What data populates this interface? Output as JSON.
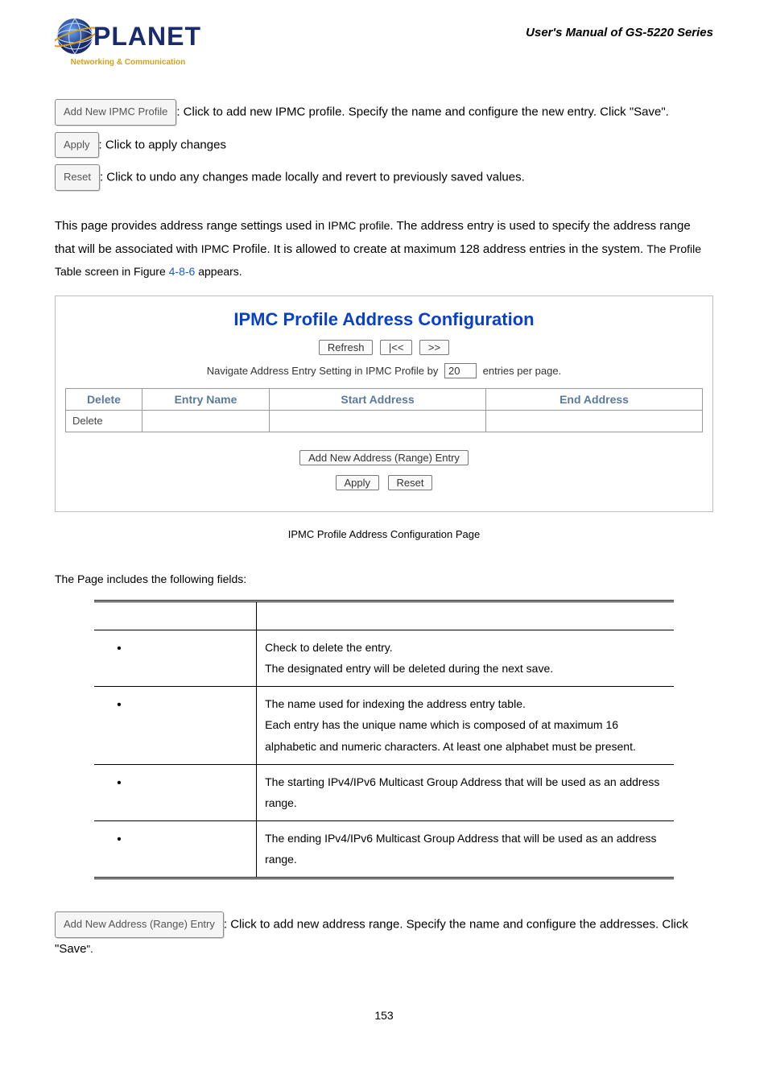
{
  "header": {
    "brand": "PLANET",
    "tagline": "Networking & Communication",
    "manual_title": "User's Manual of GS-5220 Series"
  },
  "top_buttons": {
    "add_profile": {
      "label": "Add New IPMC Profile",
      "desc": ": Click to add new IPMC profile. Specify the name and configure the new entry. Click \"Save\"."
    },
    "apply": {
      "label": "Apply",
      "desc": ": Click to apply changes"
    },
    "reset": {
      "label": "Reset",
      "desc": ": Click to undo any changes made locally and revert to previously saved values."
    }
  },
  "intro": {
    "p1a": "This page provides address range settings used in ",
    "p1b": "IPMC profile",
    "p1c": ". The address entry is used to specify the address range that will be associated with ",
    "p1d": "IPMC",
    "p1e": " Profile. It is allowed to create at maximum 128 address entries in the system. ",
    "p1f": "The Profile Table screen in Figure ",
    "fig": "4-8-6",
    "p1g": " appears."
  },
  "panel": {
    "title": "IPMC Profile Address Configuration",
    "refresh": "Refresh",
    "prev": "|<<",
    "next": ">>",
    "nav_a": "Navigate Address Entry Setting in IPMC Profile by",
    "nav_val": "20",
    "nav_b": "entries per page.",
    "th_delete": "Delete",
    "th_entry": "Entry Name",
    "th_start": "Start Address",
    "th_end": "End Address",
    "row_delete": "Delete",
    "add_range": "Add New Address (Range) Entry",
    "apply": "Apply",
    "reset": "Reset"
  },
  "caption": "IPMC Profile Address Configuration Page",
  "fields_intro": "The Page includes the following fields:",
  "fields": {
    "r1": {
      "d1": "Check to delete the entry.",
      "d2": "The designated entry will be deleted during the next save."
    },
    "r2": {
      "d1": "The name used for indexing the address entry table.",
      "d2": "Each entry has the unique name which is composed of at maximum 16 alphabetic and numeric characters. At least one alphabet must be present."
    },
    "r3": {
      "d1": "The starting IPv4/IPv6 Multicast Group Address that will be used as an address range."
    },
    "r4": {
      "d1": "The ending IPv4/IPv6 Multicast Group Address that will be used as an address range."
    }
  },
  "bottom": {
    "add_range": {
      "label": "Add New Address (Range) Entry",
      "desc1": ": Click to add new address range. Specify the name and configure the addresses. Click \"Save",
      "desc2": "\"."
    }
  },
  "page_number": "153"
}
